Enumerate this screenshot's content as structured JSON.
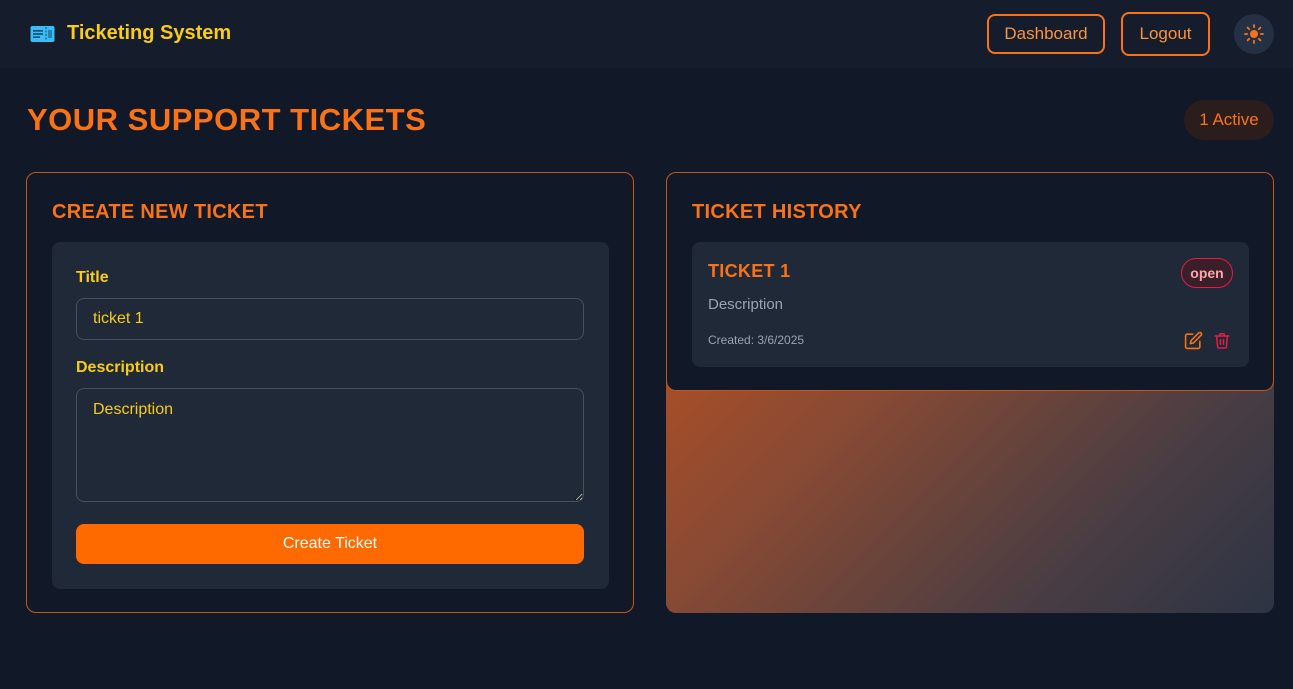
{
  "header": {
    "brand_icon": "ticket-icon",
    "app_title": "Ticketing System",
    "dashboard_label": "Dashboard",
    "logout_label": "Logout",
    "theme_icon": "sun-icon"
  },
  "page": {
    "title": "YOUR SUPPORT TICKETS",
    "active_count_label": "1 Active"
  },
  "create_form": {
    "heading": "CREATE NEW TICKET",
    "title_label": "Title",
    "title_value": "ticket 1",
    "description_label": "Description",
    "description_placeholder": "Description",
    "submit_label": "Create Ticket"
  },
  "history": {
    "heading": "TICKET HISTORY",
    "tickets": [
      {
        "title": "TICKET 1",
        "status": "open",
        "description": "Description",
        "created": "Created: 3/6/2025",
        "edit_icon": "edit-icon",
        "delete_icon": "trash-icon"
      }
    ]
  },
  "colors": {
    "background": "#111827",
    "panel": "#1f2937",
    "accent_orange": "#f97316",
    "button_orange": "#ff6a00",
    "label_yellow": "#facc15",
    "status_red": "#e11d48",
    "brand_icon_cyan": "#38bdf8"
  }
}
